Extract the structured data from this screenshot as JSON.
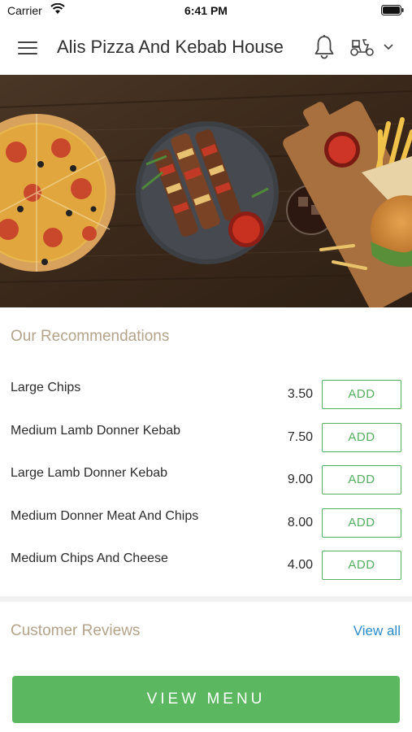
{
  "status_bar": {
    "carrier": "Carrier",
    "time": "6:41 PM"
  },
  "header": {
    "title": "Alis Pizza And Kebab House"
  },
  "recommendations": {
    "title": "Our Recommendations",
    "items": [
      {
        "name": "Large Chips",
        "price": "3.50",
        "button": "ADD"
      },
      {
        "name": "Medium Lamb Donner Kebab",
        "price": "7.50",
        "button": "ADD"
      },
      {
        "name": "Large Lamb Donner Kebab",
        "price": "9.00",
        "button": "ADD"
      },
      {
        "name": "Medium Donner Meat And Chips",
        "price": "8.00",
        "button": "ADD"
      },
      {
        "name": "Medium Chips And Cheese",
        "price": "4.00",
        "button": "ADD"
      }
    ]
  },
  "reviews": {
    "title": "Customer Reviews",
    "view_all": "View all"
  },
  "footer": {
    "view_menu": "VIEW MENU"
  },
  "colors": {
    "accent_green": "#5cb860",
    "link_blue": "#2a8bc9",
    "section_title": "#b5a38a"
  }
}
